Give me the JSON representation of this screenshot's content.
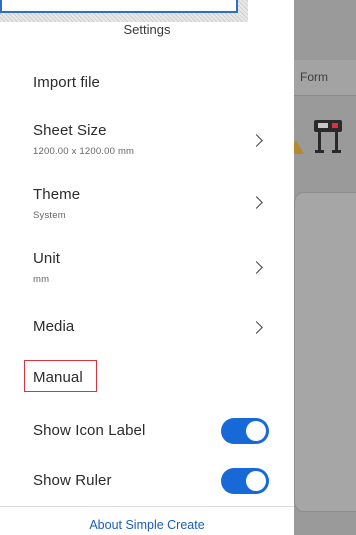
{
  "background": {
    "tab_label": "Form",
    "icons": [
      "warning-icon",
      "plotter-icon"
    ]
  },
  "settings": {
    "title": "Settings",
    "items": [
      {
        "label": "Import file"
      },
      {
        "label": "Sheet Size",
        "value": "1200.00 x 1200.00 mm"
      },
      {
        "label": "Theme",
        "value": "System"
      },
      {
        "label": "Unit",
        "value": "mm"
      },
      {
        "label": "Media"
      },
      {
        "label": "Manual"
      },
      {
        "label": "Show Icon Label",
        "toggle": true
      },
      {
        "label": "Show Ruler",
        "toggle": true
      }
    ],
    "footer_link": "About Simple Create",
    "accent_color": "#1769d8",
    "highlight_color": "#d9333f"
  }
}
